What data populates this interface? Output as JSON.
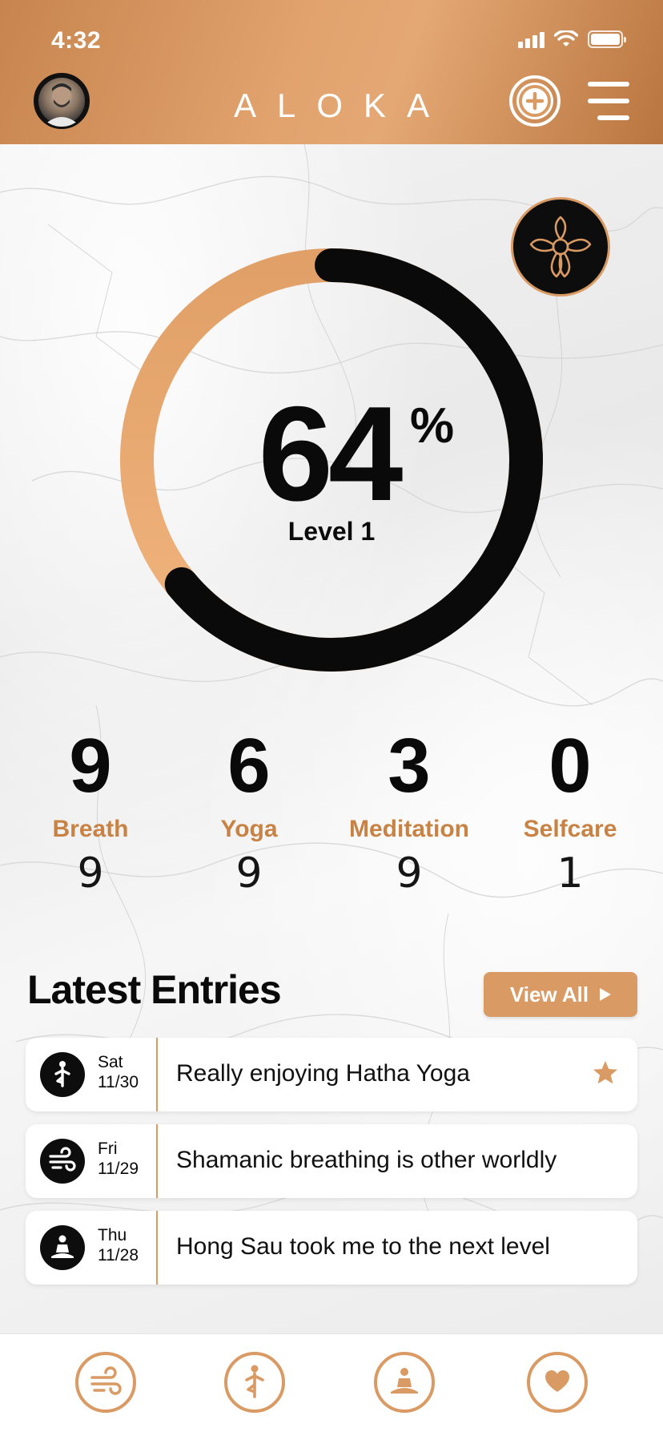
{
  "status_bar": {
    "time": "4:32"
  },
  "header": {
    "title": "ALOKA"
  },
  "progress": {
    "percent_value": "64",
    "percent_sign": "%",
    "fraction": 0.64,
    "level": "Level 1"
  },
  "stats": [
    {
      "value": "9",
      "label": "Breath",
      "goal": "9"
    },
    {
      "value": "6",
      "label": "Yoga",
      "goal": "9"
    },
    {
      "value": "3",
      "label": "Meditation",
      "goal": "9"
    },
    {
      "value": "0",
      "label": "Selfcare",
      "goal": "1"
    }
  ],
  "latest": {
    "title": "Latest Entries",
    "view_all_label": "View All",
    "entries": [
      {
        "day": "Sat",
        "date": "11/30",
        "text": "Really enjoying Hatha Yoga",
        "icon": "yoga-icon",
        "starred": true
      },
      {
        "day": "Fri",
        "date": "11/29",
        "text": "Shamanic breathing is other worldly",
        "icon": "breath-icon",
        "starred": false
      },
      {
        "day": "Thu",
        "date": "11/28",
        "text": "Hong Sau took me to the next level",
        "icon": "meditation-icon",
        "starred": false
      }
    ]
  },
  "nav": [
    "breath-icon",
    "yoga-icon",
    "meditation-icon",
    "heart-icon"
  ],
  "colors": {
    "accent": "#d99a63",
    "accent_dark": "#c88243",
    "ring_track": "#0a0a0a"
  }
}
